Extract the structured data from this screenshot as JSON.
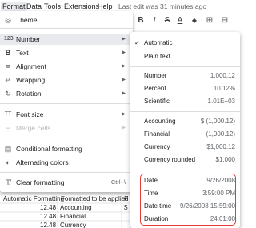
{
  "menubar": {
    "items": [
      "Format",
      "Data",
      "Tools",
      "Extensions",
      "Help"
    ],
    "last_edit": "Last edit was 31 minutes ago"
  },
  "toolbar": {
    "bold": "B",
    "italic": "I",
    "strike": "S",
    "text_color": "A",
    "fill": "◆",
    "borders": "⊞",
    "merge": "⊟"
  },
  "format_menu": {
    "theme": "Theme",
    "number": "Number",
    "text": "Text",
    "alignment": "Alignment",
    "wrapping": "Wrapping",
    "rotation": "Rotation",
    "font_size": "Font size",
    "merge_cells": "Merge cells",
    "conditional_formatting": "Conditional formatting",
    "alternating_colors": "Alternating colors",
    "clear_formatting": "Clear formatting",
    "clear_shortcut": "Ctrl+\\"
  },
  "number_submenu": {
    "automatic": "Automatic",
    "plain_text": "Plain text",
    "number": {
      "label": "Number",
      "value": "1,000.12"
    },
    "percent": {
      "label": "Percent",
      "value": "10.12%"
    },
    "scientific": {
      "label": "Scientific",
      "value": "1.01E+03"
    },
    "accounting": {
      "label": "Accounting",
      "value": "$ (1,000.12)"
    },
    "financial": {
      "label": "Financial",
      "value": "(1,000.12)"
    },
    "currency": {
      "label": "Currency",
      "value": "$1,000.12"
    },
    "currency_rounded": {
      "label": "Currency rounded",
      "value": "$1,000"
    },
    "date": {
      "label": "Date",
      "value": "9/26/2008"
    },
    "time": {
      "label": "Time",
      "value": "3:59:00 PM"
    },
    "date_time": {
      "label": "Date time",
      "value": "9/26/2008 15:59:00"
    },
    "duration": {
      "label": "Duration",
      "value": "24:01:00"
    }
  },
  "sheet": {
    "headers": [
      "Automatic Formatting",
      "Formatted to be applied",
      "F"
    ],
    "rows": [
      {
        "value": "12.48",
        "format": "Accounting",
        "extra": "$"
      },
      {
        "value": "12.48",
        "format": "Financial",
        "extra": ""
      },
      {
        "value": "12.48",
        "format": "Currency",
        "extra": ""
      }
    ]
  }
}
